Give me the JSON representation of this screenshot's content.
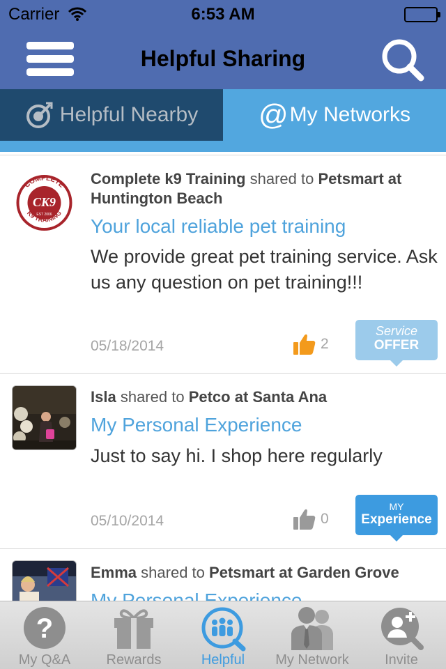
{
  "status_bar": {
    "carrier": "Carrier",
    "time": "6:53 AM"
  },
  "nav": {
    "title": "Helpful Sharing",
    "menu_icon": "hamburger-icon",
    "search_icon": "search-icon"
  },
  "segments": {
    "nearby": {
      "label": "Helpful Nearby",
      "icon": "target-arrow-icon"
    },
    "networks": {
      "label": "My Networks",
      "icon_text": "@"
    },
    "active": "networks"
  },
  "posts": [
    {
      "author": "Complete k9 Training",
      "shared_text": "shared to",
      "location": "Petsmart at Huntington Beach",
      "title": "Your local reliable pet training",
      "body": "We provide great pet training service. Ask us any question on pet training!!!",
      "date": "05/18/2014",
      "likes": "2",
      "liked": true,
      "badge": {
        "line1": "Service",
        "line2": "OFFER"
      },
      "avatar": {
        "type": "logo",
        "text": "CK9",
        "ring_top": "COMPLETE",
        "ring_bottom": "K9 TRAINING",
        "est": "EST 2006"
      }
    },
    {
      "author": "Isla",
      "shared_text": "shared to",
      "location": "Petco at Santa Ana",
      "title": "My Personal Experience",
      "body": "Just to say hi. I shop here regularly",
      "date": "05/10/2014",
      "likes": "0",
      "liked": false,
      "badge": {
        "line1": "MY",
        "line2": "Experience"
      },
      "avatar": {
        "type": "photo"
      }
    },
    {
      "author": "Emma",
      "shared_text": "shared to",
      "location": "Petsmart at Garden Grove",
      "title": "My Personal Experience",
      "avatar": {
        "type": "photo"
      }
    }
  ],
  "tabbar": {
    "items": [
      {
        "label": "My Q&A",
        "icon": "question-icon"
      },
      {
        "label": "Rewards",
        "icon": "gift-icon"
      },
      {
        "label": "Helpful",
        "icon": "people-group-icon"
      },
      {
        "label": "My Network",
        "icon": "business-people-icon"
      },
      {
        "label": "Invite",
        "icon": "add-person-icon"
      }
    ],
    "active_index": 2
  },
  "colors": {
    "nav_bar": "#4f6cb0",
    "segment_active": "#52a7df",
    "segment_inactive": "#1f4a6e",
    "link_blue": "#4fa3dc",
    "like_orange": "#f39a1c",
    "badge_offer": "#9ccbeb",
    "badge_experience": "#3d9be0"
  }
}
